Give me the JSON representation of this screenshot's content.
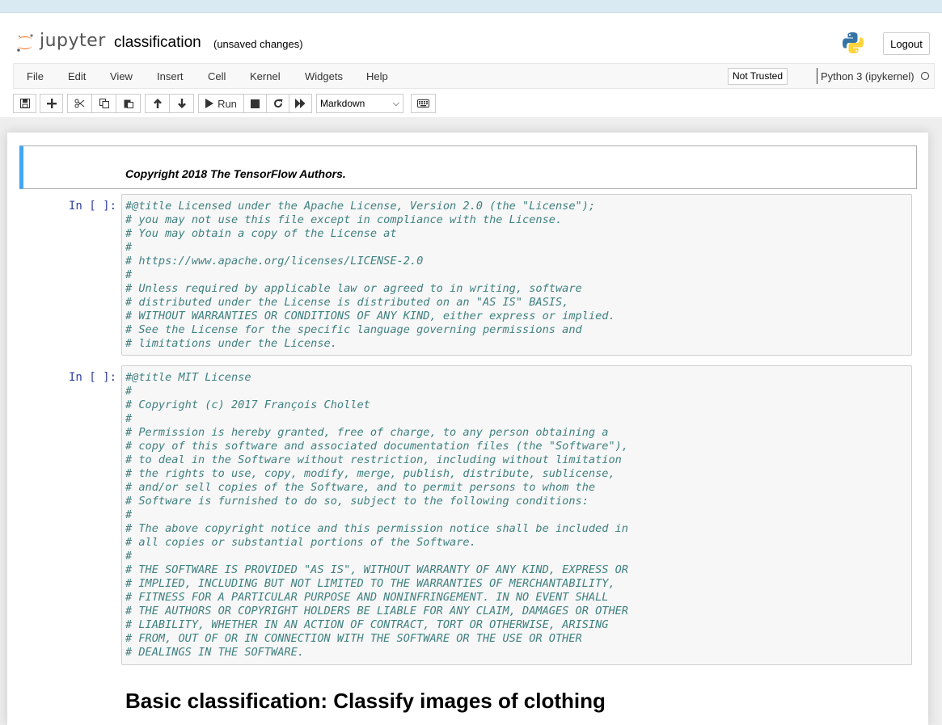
{
  "header": {
    "logo_text": "jupyter",
    "notebook_name": "classification",
    "save_status": "(unsaved changes)",
    "logout_label": "Logout"
  },
  "menubar": {
    "items": [
      "File",
      "Edit",
      "View",
      "Insert",
      "Cell",
      "Kernel",
      "Widgets",
      "Help"
    ],
    "trust_status": "Not Trusted",
    "kernel_name": "Python 3 (ipykernel)"
  },
  "toolbar": {
    "run_label": "Run",
    "cell_type": "Markdown",
    "icons": [
      "save-icon",
      "plus-icon",
      "cut-icon",
      "copy-icon",
      "paste-icon",
      "arrow-up-icon",
      "arrow-down-icon",
      "play-icon",
      "stop-icon",
      "restart-icon",
      "fast-forward-icon",
      "keyboard-icon"
    ]
  },
  "cells": {
    "markdown_1": {
      "text": "Copyright 2018 The TensorFlow Authors."
    },
    "code_1": {
      "prompt": "In [ ]:",
      "lines": [
        "#@title Licensed under the Apache License, Version 2.0 (the \"License\");",
        "# you may not use this file except in compliance with the License.",
        "# You may obtain a copy of the License at",
        "#",
        "# https://www.apache.org/licenses/LICENSE-2.0",
        "#",
        "# Unless required by applicable law or agreed to in writing, software",
        "# distributed under the License is distributed on an \"AS IS\" BASIS,",
        "# WITHOUT WARRANTIES OR CONDITIONS OF ANY KIND, either express or implied.",
        "# See the License for the specific language governing permissions and",
        "# limitations under the License."
      ]
    },
    "code_2": {
      "prompt": "In [ ]:",
      "lines": [
        "#@title MIT License",
        "#",
        "# Copyright (c) 2017 François Chollet",
        "#",
        "# Permission is hereby granted, free of charge, to any person obtaining a",
        "# copy of this software and associated documentation files (the \"Software\"),",
        "# to deal in the Software without restriction, including without limitation",
        "# the rights to use, copy, modify, merge, publish, distribute, sublicense,",
        "# and/or sell copies of the Software, and to permit persons to whom the",
        "# Software is furnished to do so, subject to the following conditions:",
        "#",
        "# The above copyright notice and this permission notice shall be included in",
        "# all copies or substantial portions of the Software.",
        "#",
        "# THE SOFTWARE IS PROVIDED \"AS IS\", WITHOUT WARRANTY OF ANY KIND, EXPRESS OR",
        "# IMPLIED, INCLUDING BUT NOT LIMITED TO THE WARRANTIES OF MERCHANTABILITY,",
        "# FITNESS FOR A PARTICULAR PURPOSE AND NONINFRINGEMENT. IN NO EVENT SHALL",
        "# THE AUTHORS OR COPYRIGHT HOLDERS BE LIABLE FOR ANY CLAIM, DAMAGES OR OTHER",
        "# LIABILITY, WHETHER IN AN ACTION OF CONTRACT, TORT OR OTHERWISE, ARISING",
        "# FROM, OUT OF OR IN CONNECTION WITH THE SOFTWARE OR THE USE OR OTHER",
        "# DEALINGS IN THE SOFTWARE."
      ]
    },
    "markdown_2": {
      "text": "Basic classification: Classify images of clothing"
    }
  },
  "colors": {
    "accent": "#42a5f5",
    "prompt": "#303f9f",
    "comment": "#408080",
    "top_strip": "#daeaf3"
  }
}
